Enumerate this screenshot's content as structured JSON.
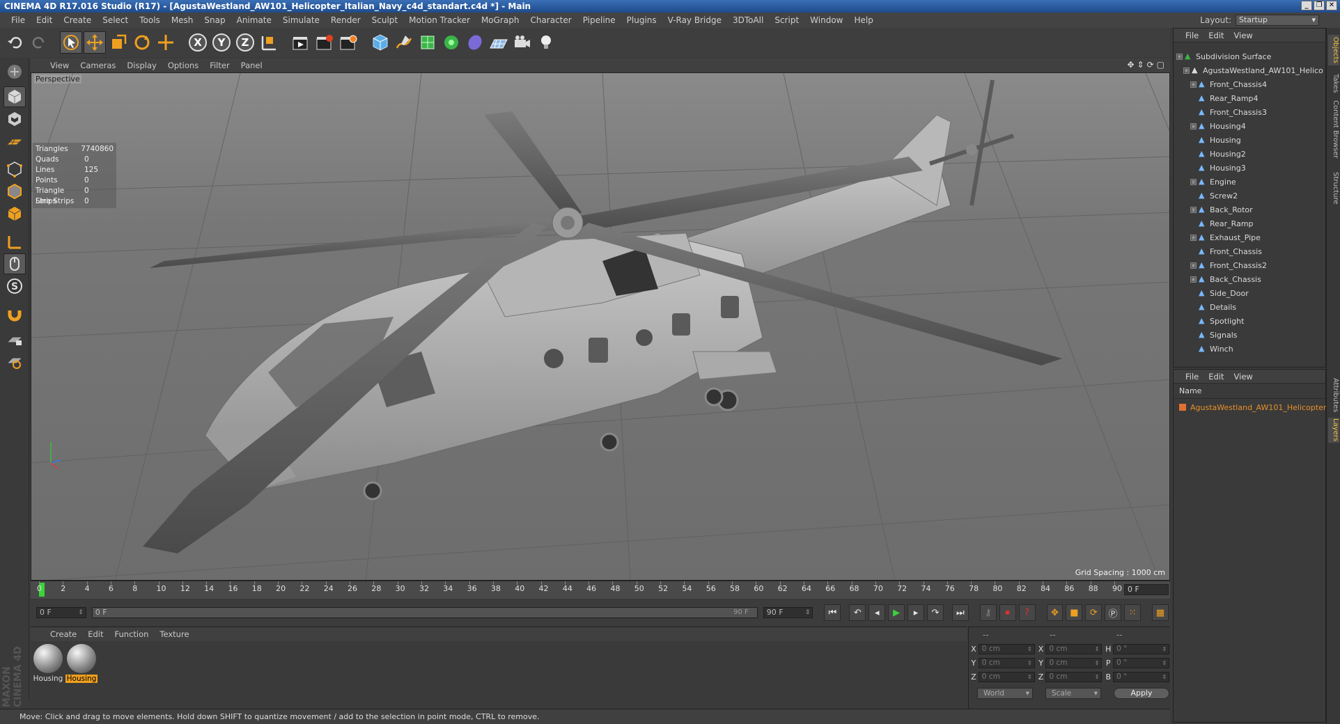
{
  "window": {
    "title": "CINEMA 4D R17.016 Studio (R17) - [AgustaWestland_AW101_Helicopter_Italian_Navy_c4d_standart.c4d *] - Main"
  },
  "menu": [
    "File",
    "Edit",
    "Create",
    "Select",
    "Tools",
    "Mesh",
    "Snap",
    "Animate",
    "Simulate",
    "Render",
    "Sculpt",
    "Motion Tracker",
    "MoGraph",
    "Character",
    "Pipeline",
    "Plugins",
    "V-Ray Bridge",
    "3DToAll",
    "Script",
    "Window",
    "Help"
  ],
  "layout": {
    "label": "Layout:",
    "value": "Startup"
  },
  "toolbar": {
    "x": "X",
    "y": "Y",
    "z": "Z"
  },
  "viewport": {
    "menu": [
      "View",
      "Cameras",
      "Display",
      "Options",
      "Filter",
      "Panel"
    ],
    "label": "Perspective",
    "grid_spacing": "Grid Spacing : 1000 cm",
    "stats": [
      {
        "k": "Triangles",
        "v": "7740860"
      },
      {
        "k": "Quads",
        "v": "0"
      },
      {
        "k": "Lines",
        "v": "125"
      },
      {
        "k": "Points",
        "v": "0"
      },
      {
        "k": "Triangle Strips",
        "v": "0"
      },
      {
        "k": "Line Strips",
        "v": "0"
      }
    ]
  },
  "timeline": {
    "ticks": [
      "0",
      "2",
      "4",
      "6",
      "8",
      "10",
      "12",
      "14",
      "16",
      "18",
      "20",
      "22",
      "24",
      "26",
      "28",
      "30",
      "32",
      "34",
      "36",
      "38",
      "40",
      "42",
      "44",
      "46",
      "48",
      "50",
      "52",
      "54",
      "56",
      "58",
      "60",
      "62",
      "64",
      "66",
      "68",
      "70",
      "72",
      "74",
      "76",
      "78",
      "80",
      "82",
      "84",
      "86",
      "88",
      "90"
    ],
    "frame_end": "0 F"
  },
  "transport": {
    "start": "0 F",
    "slider_start": "0 F",
    "slider_end": "90 F",
    "end": "90 F"
  },
  "materials": {
    "menu": [
      "Create",
      "Edit",
      "Function",
      "Texture"
    ],
    "items": [
      "Housing",
      "Housing"
    ]
  },
  "coords": {
    "header": [
      "--",
      "--",
      "--"
    ],
    "rows": [
      {
        "a": "X",
        "av": "0 cm",
        "b": "X",
        "bv": "0 cm",
        "c": "H",
        "cv": "0 °"
      },
      {
        "a": "Y",
        "av": "0 cm",
        "b": "Y",
        "bv": "0 cm",
        "c": "P",
        "cv": "0 °"
      },
      {
        "a": "Z",
        "av": "0 cm",
        "b": "Z",
        "bv": "0 cm",
        "c": "B",
        "cv": "0 °"
      }
    ],
    "mode": "World",
    "scale": "Scale",
    "apply": "Apply"
  },
  "status": "Move: Click and drag to move elements. Hold down SHIFT to quantize movement / add to the selection in point mode, CTRL to remove.",
  "brand": "MAXON CINEMA 4D",
  "objects": {
    "menu": [
      "File",
      "Edit",
      "View"
    ],
    "root": "Subdivision Surface",
    "group": "AgustaWestland_AW101_Helico",
    "items": [
      "Front_Chassis4",
      "Rear_Ramp4",
      "Front_Chassis3",
      "Housing4",
      "Housing",
      "Housing2",
      "Housing3",
      "Engine",
      "Screw2",
      "Back_Rotor",
      "Rear_Ramp",
      "Exhaust_Pipe",
      "Front_Chassis",
      "Front_Chassis2",
      "Back_Chassis",
      "Side_Door",
      "Details",
      "Spotlight",
      "Signals",
      "Winch"
    ]
  },
  "layers": {
    "menu": [
      "File",
      "Edit",
      "View"
    ],
    "column": "Name",
    "item": "AgustaWestland_AW101_Helicopter"
  },
  "sidetabs": [
    "Objects",
    "Takes",
    "Content Browser",
    "Structure",
    "Attributes",
    "Layers"
  ],
  "colors": {
    "accent": "#f0a020",
    "selection": "#e8902a",
    "titlebar": "#2a5ea6"
  }
}
